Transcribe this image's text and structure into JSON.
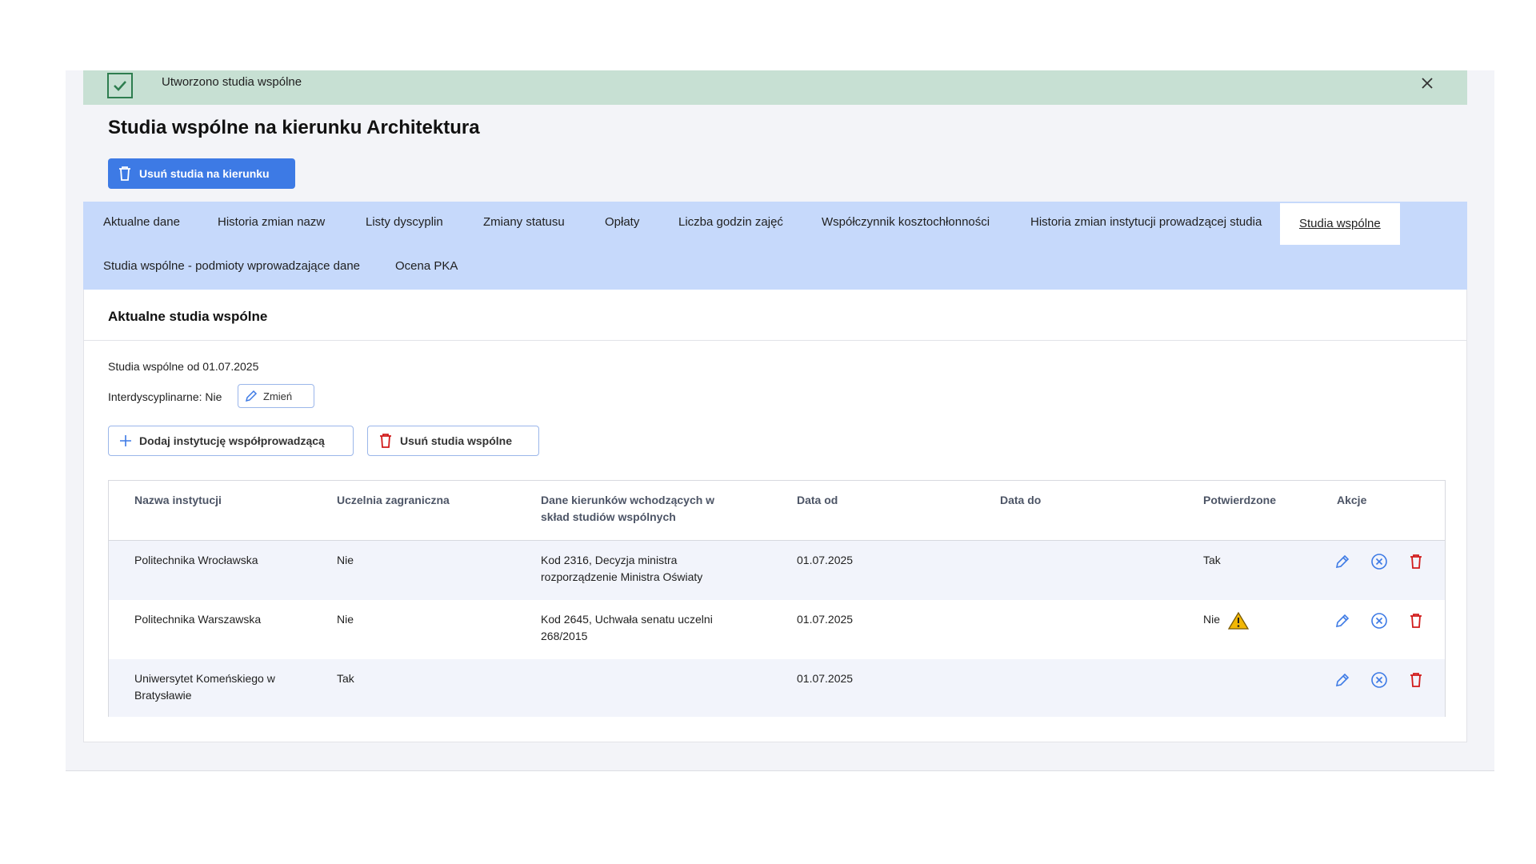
{
  "alert": {
    "message": "Utworzono studia wspólne",
    "icon": "check-icon",
    "close_icon": "close-icon",
    "bg_color": "#c7e0d3"
  },
  "page": {
    "title": "Studia wspólne na kierunku Architektura"
  },
  "primary_action": {
    "label": "Usuń studia na kierunku",
    "icon": "trash-icon",
    "color": "#3d7ae5"
  },
  "tabs": [
    {
      "label": "Aktualne dane"
    },
    {
      "label": "Historia zmian nazw"
    },
    {
      "label": "Listy dyscyplin"
    },
    {
      "label": "Zmiany statusu"
    },
    {
      "label": "Opłaty"
    },
    {
      "label": "Liczba godzin zajęć"
    },
    {
      "label": "Współczynnik kosztochłonności"
    },
    {
      "label": "Historia zmian instytucji prowadzącej studia"
    },
    {
      "label": "Studia wspólne",
      "active": true
    },
    {
      "label": "Studia wspólne - podmioty wprowadzające dane"
    },
    {
      "label": "Ocena PKA"
    }
  ],
  "panel": {
    "title": "Aktualne studia wspólne",
    "since_text": "Studia wspólne od 01.07.2025",
    "interdisciplinary_text": "Interdyscyplinarne: Nie",
    "change_label": "Zmień",
    "add_label": "Dodaj instytucję współprowadzącą",
    "remove_label": "Usuń studia wspólne"
  },
  "table": {
    "headers": [
      "Nazwa instytucji",
      "Uczelnia zagraniczna",
      "Dane kierunków wchodzących w skład studiów wspólnych",
      "Data od",
      "Data do",
      "Potwierdzone",
      "Akcje"
    ],
    "rows": [
      {
        "name": "Politechnika Wrocławska",
        "foreign": "Nie",
        "details": "Kod 2316, Decyzja ministra rozporządzenie Ministra Oświaty",
        "date_from": "01.07.2025",
        "date_to": "",
        "confirmed": "Tak",
        "warning": false
      },
      {
        "name": "Politechnika Warszawska",
        "foreign": "Nie",
        "details": "Kod 2645, Uchwała senatu uczelni 268/2015",
        "date_from": "01.07.2025",
        "date_to": "",
        "confirmed": "Nie",
        "warning": true
      },
      {
        "name": "Uniwersytet Komeńskiego w Bratysławie",
        "foreign": "Tak",
        "details": "",
        "date_from": "01.07.2025",
        "date_to": "",
        "confirmed": "",
        "warning": false
      }
    ],
    "action_icons": [
      "pencil-icon",
      "cancel-circle-icon",
      "trash-icon"
    ],
    "colors": {
      "edit": "#3d7ae5",
      "delete": "#d11a1a",
      "warning": "#f2b705"
    }
  }
}
